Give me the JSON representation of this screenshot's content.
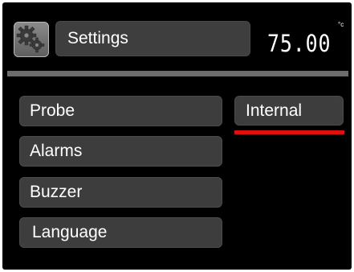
{
  "header": {
    "icon": "gears-icon",
    "title": "Settings",
    "temperature": "75.00",
    "unit": "°c"
  },
  "menu": {
    "items": [
      {
        "label": "Probe"
      },
      {
        "label": "Alarms"
      },
      {
        "label": "Buzzer"
      },
      {
        "label": "Language"
      }
    ]
  },
  "selection": {
    "value": "Internal"
  },
  "colors": {
    "background": "#000000",
    "button": "#3d3d3d",
    "divider": "#6c6c6c",
    "accent_underline": "#e01010",
    "text": "#ffffff"
  }
}
